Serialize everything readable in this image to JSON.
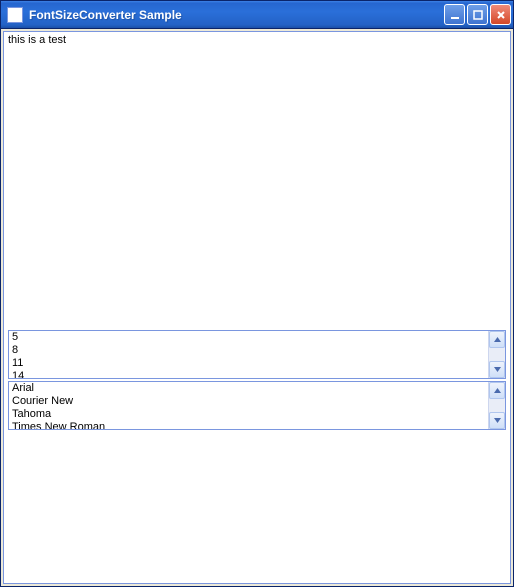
{
  "window": {
    "title": "FontSizeConverter Sample"
  },
  "content": {
    "text": "this is a test"
  },
  "sizeList": {
    "items": [
      "5",
      "8",
      "11",
      "14"
    ]
  },
  "fontList": {
    "items": [
      "Arial",
      "Courier New",
      "Tahoma",
      "Times New Roman"
    ]
  }
}
